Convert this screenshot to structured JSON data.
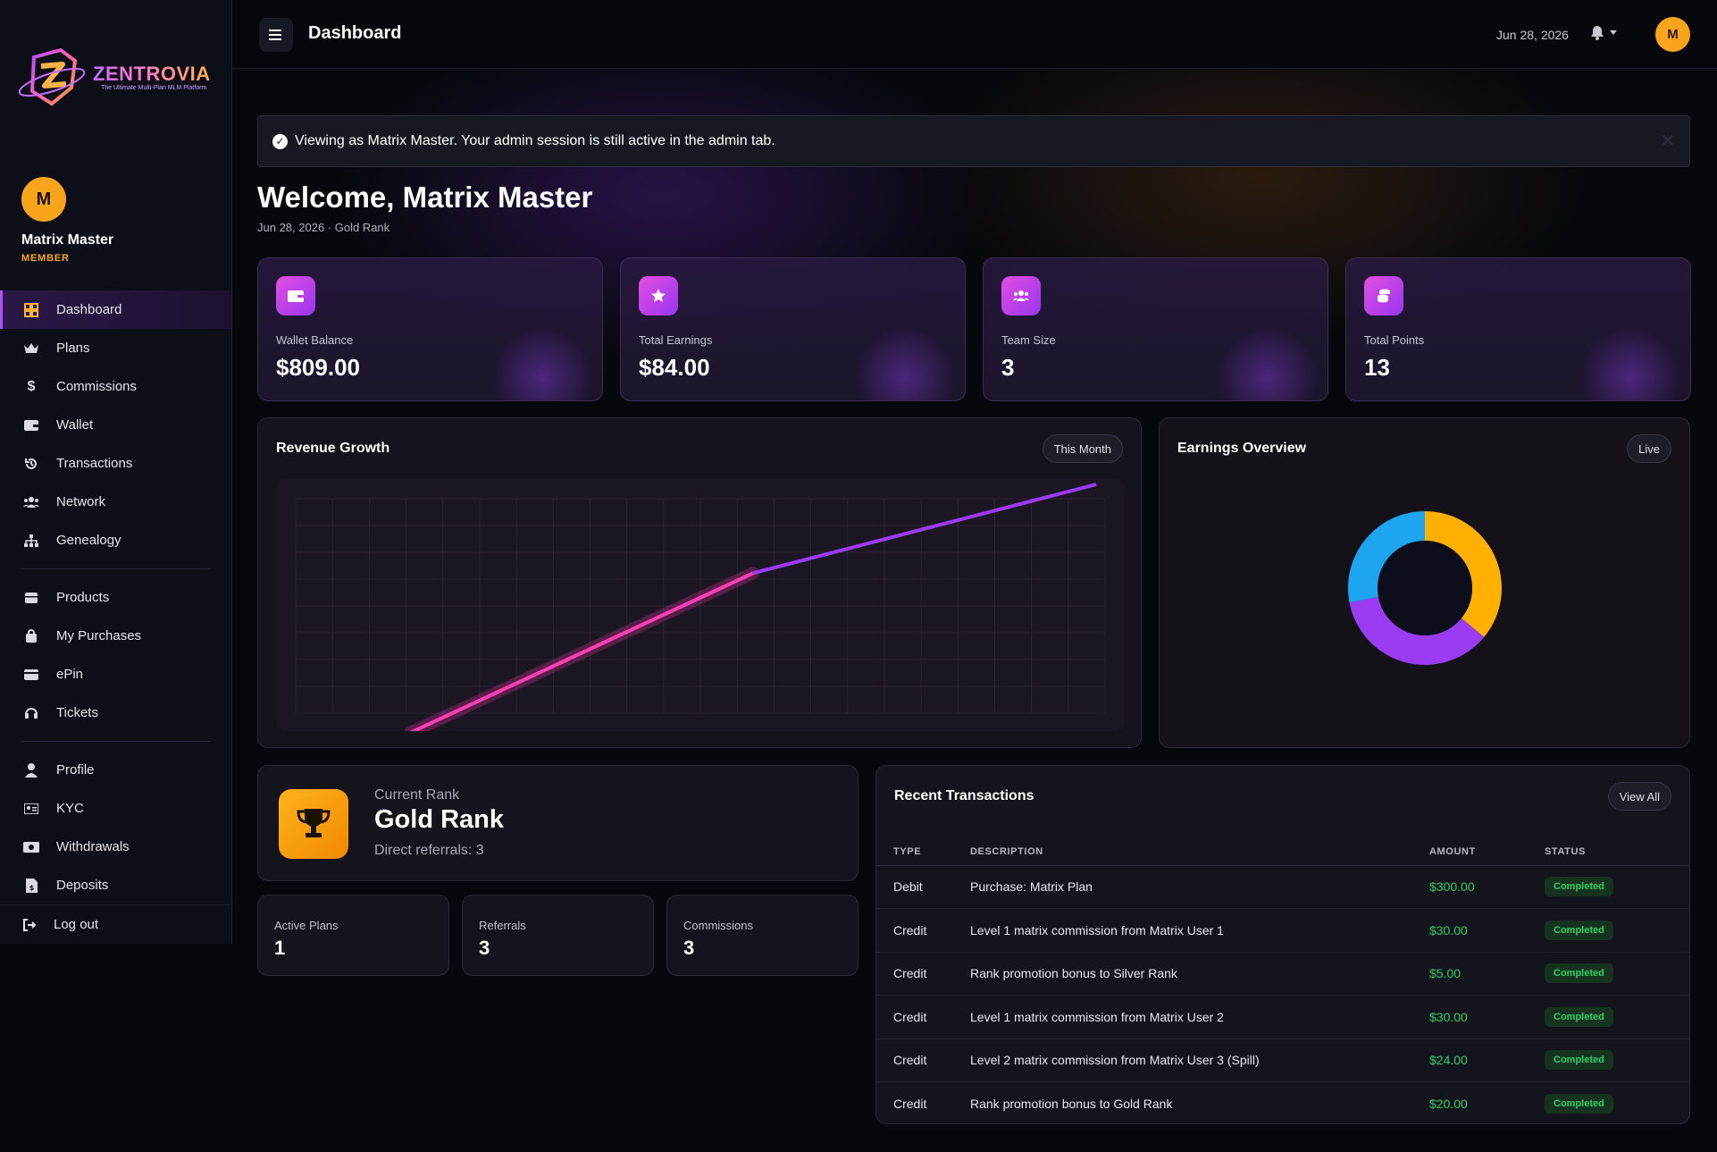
{
  "brand": {
    "name": "ZENTROVIA",
    "tagline": "The Ultimate Multi-Plan MLM Platform"
  },
  "user": {
    "initial": "M",
    "name": "Matrix Master",
    "role": "MEMBER"
  },
  "nav": {
    "items": [
      {
        "label": "Dashboard",
        "icon": "dashboard-grid-icon"
      },
      {
        "label": "Plans",
        "icon": "crown-icon"
      },
      {
        "label": "Commissions",
        "icon": "dollar-icon"
      },
      {
        "label": "Wallet",
        "icon": "wallet-icon"
      },
      {
        "label": "Transactions",
        "icon": "history-icon"
      },
      {
        "label": "Network",
        "icon": "users-icon"
      },
      {
        "label": "Genealogy",
        "icon": "sitemap-icon"
      },
      {
        "label": "Products",
        "icon": "box-icon"
      },
      {
        "label": "My Purchases",
        "icon": "shopping-bag-icon"
      },
      {
        "label": "ePin",
        "icon": "card-icon"
      },
      {
        "label": "Tickets",
        "icon": "headset-icon"
      },
      {
        "label": "Profile",
        "icon": "user-icon"
      },
      {
        "label": "KYC",
        "icon": "id-card-icon"
      },
      {
        "label": "Withdrawals",
        "icon": "money-icon"
      },
      {
        "label": "Deposits",
        "icon": "file-dollar-icon"
      }
    ],
    "logout": "Log out"
  },
  "header": {
    "title": "Dashboard",
    "date": "Jun 28, 2026",
    "avatar_initial": "M"
  },
  "alert": {
    "text": "Viewing as Matrix Master. Your admin session is still active in the admin tab."
  },
  "welcome": {
    "title": "Welcome, Matrix Master",
    "subline": "Jun 28, 2026 · Gold Rank"
  },
  "stats": [
    {
      "label": "Wallet Balance",
      "value": "$809.00",
      "icon": "wallet-icon"
    },
    {
      "label": "Total Earnings",
      "value": "$84.00",
      "icon": "star-icon"
    },
    {
      "label": "Team Size",
      "value": "3",
      "icon": "users-icon"
    },
    {
      "label": "Total Points",
      "value": "13",
      "icon": "coins-icon"
    }
  ],
  "revenue": {
    "title": "Revenue Growth",
    "range": "This Month"
  },
  "earnings": {
    "title": "Earnings Overview",
    "status": "Live"
  },
  "rank": {
    "label": "Current Rank",
    "name": "Gold Rank",
    "referrals": "Direct referrals: 3"
  },
  "mini_stats": [
    {
      "label": "Active Plans",
      "value": "1"
    },
    {
      "label": "Referrals",
      "value": "3"
    },
    {
      "label": "Commissions",
      "value": "3"
    }
  ],
  "transactions": {
    "title": "Recent Transactions",
    "view_all": "View All",
    "columns": [
      "TYPE",
      "DESCRIPTION",
      "AMOUNT",
      "STATUS"
    ],
    "rows": [
      {
        "type": "Debit",
        "description": "Purchase: Matrix Plan",
        "amount": "$300.00",
        "status": "Completed"
      },
      {
        "type": "Credit",
        "description": "Level 1 matrix commission from Matrix User 1",
        "amount": "$30.00",
        "status": "Completed"
      },
      {
        "type": "Credit",
        "description": "Rank promotion bonus to Silver Rank",
        "amount": "$5.00",
        "status": "Completed"
      },
      {
        "type": "Credit",
        "description": "Level 1 matrix commission from Matrix User 2",
        "amount": "$30.00",
        "status": "Completed"
      },
      {
        "type": "Credit",
        "description": "Level 2 matrix commission from Matrix User 3 (Spill)",
        "amount": "$24.00",
        "status": "Completed"
      },
      {
        "type": "Credit",
        "description": "Rank promotion bonus to Gold Rank",
        "amount": "$20.00",
        "status": "Completed"
      }
    ]
  },
  "chart_data": [
    {
      "type": "line",
      "title": "Revenue Growth",
      "x": [
        0,
        1,
        2
      ],
      "values": [
        0,
        54,
        84
      ],
      "grid": true,
      "colors": [
        "#ff3fb4",
        "#9b3bf2"
      ]
    },
    {
      "type": "pie",
      "title": "Earnings Overview",
      "slices": [
        {
          "share": 0.36,
          "color": "#ffb000"
        },
        {
          "share": 0.36,
          "color": "#9b3bf2"
        },
        {
          "share": 0.28,
          "color": "#1ea5f0"
        }
      ]
    }
  ],
  "colors": {
    "accent_purple": "#b54bff",
    "accent_orange": "#f8a51c",
    "success": "#2ed06a"
  }
}
